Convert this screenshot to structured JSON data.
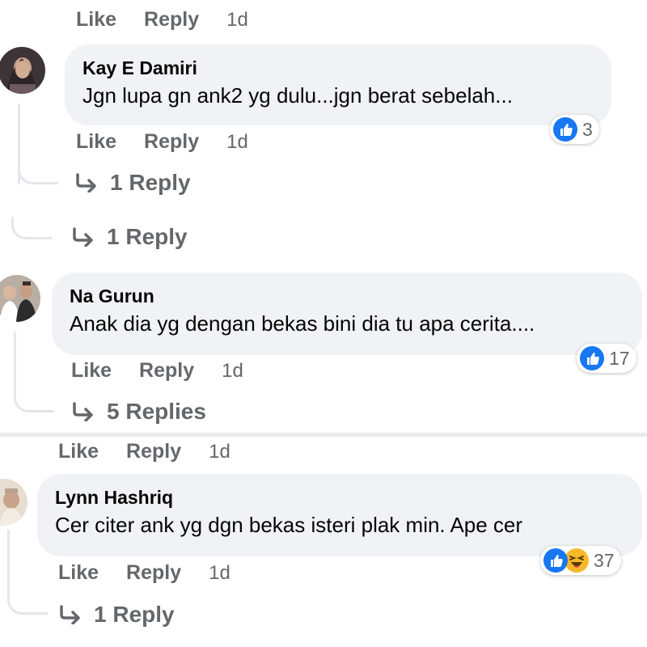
{
  "top_actions": {
    "like": "Like",
    "reply": "Reply",
    "time": "1d"
  },
  "comments": [
    {
      "author": "Kay E Damiri",
      "text": "Jgn lupa gn ank2 yg dulu...jgn berat sebelah...",
      "reactions": {
        "icons": [
          "like-icon"
        ],
        "count": "3"
      },
      "actions": {
        "like": "Like",
        "reply": "Reply",
        "time": "1d"
      },
      "replies_label": "1 Reply"
    },
    {
      "author": "Na Gurun",
      "text": "Anak dia yg dengan bekas bini dia tu apa cerita....",
      "reactions": {
        "icons": [
          "like-icon"
        ],
        "count": "17"
      },
      "actions": {
        "like": "Like",
        "reply": "Reply",
        "time": "1d"
      },
      "replies_label": "5 Replies"
    },
    {
      "author": "Lynn Hashriq",
      "text": "Cer citer ank yg dgn bekas isteri plak min. Ape cer",
      "reactions": {
        "icons": [
          "like-icon",
          "haha-icon"
        ],
        "count": "37"
      },
      "actions": {
        "like": "Like",
        "reply": "Reply",
        "time": "1d"
      },
      "replies_label": "1 Reply"
    }
  ],
  "parent_replies_label": "1 Reply",
  "second_parent_actions": {
    "like": "Like",
    "reply": "Reply",
    "time": "1d"
  },
  "colors": {
    "like_blue": "#1877f2",
    "haha_yellow": "#f7b928",
    "bubble_bg": "#f0f2f5",
    "muted_text": "#65676b"
  }
}
